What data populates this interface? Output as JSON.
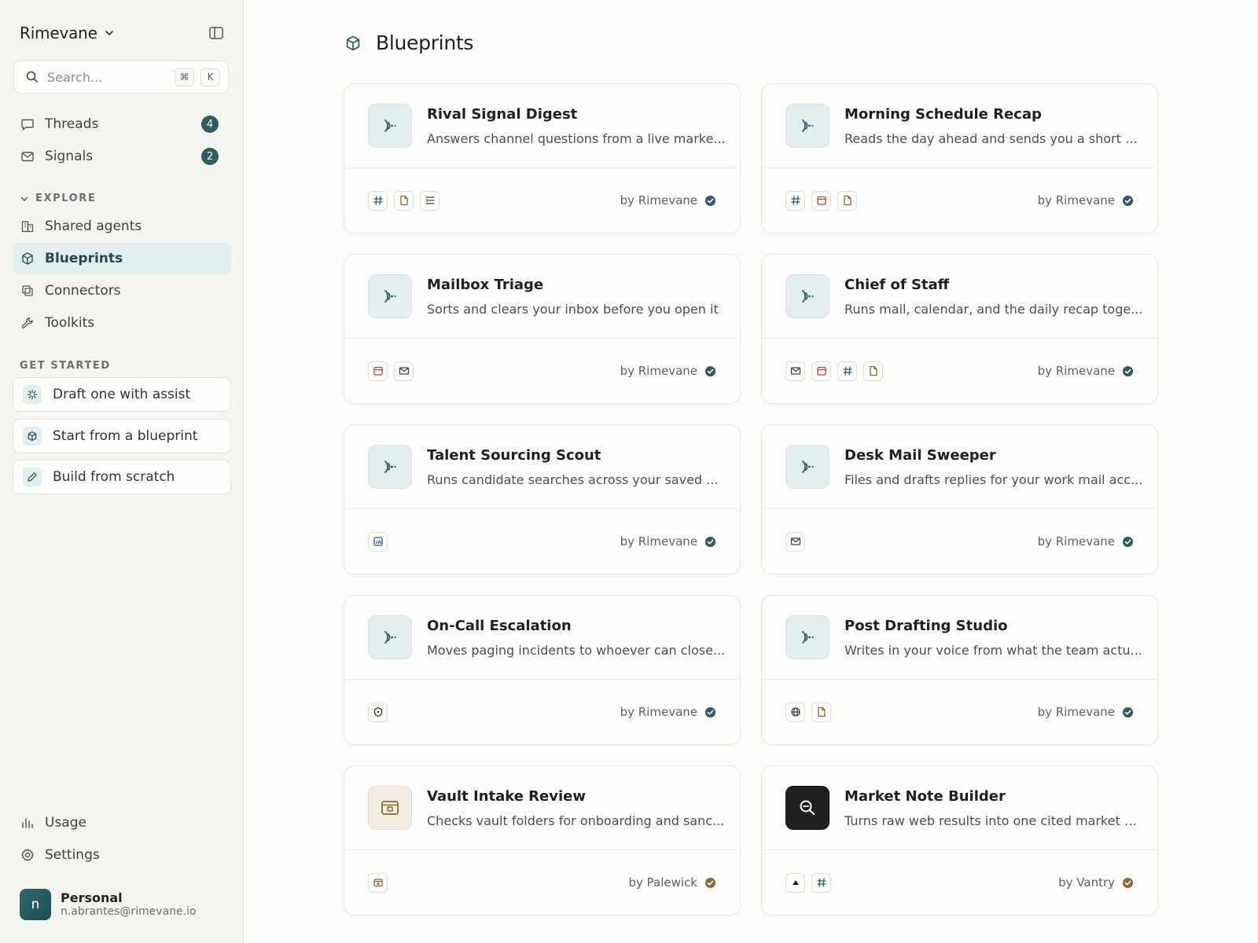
{
  "workspace": {
    "name": "Rimevane"
  },
  "search": {
    "placeholder": "Search...",
    "kbd1": "⌘",
    "kbd2": "K"
  },
  "nav": {
    "threads": {
      "label": "Threads",
      "count": "4"
    },
    "signals": {
      "label": "Signals",
      "count": "2"
    },
    "explore_heading": "EXPLORE",
    "shared_agents": "Shared agents",
    "blueprints": "Blueprints",
    "connectors": "Connectors",
    "toolkits": "Toolkits",
    "get_started_heading": "GET STARTED",
    "draft_assist": "Draft one with assist",
    "start_blueprint": "Start from a blueprint",
    "build_scratch": "Build from scratch",
    "usage": "Usage",
    "settings": "Settings"
  },
  "profile": {
    "initial": "n",
    "name": "Personal",
    "email": "n.abrantes@rimevane.io"
  },
  "page": {
    "title": "Blueprints"
  },
  "colors": {
    "accent": "#2f5d63",
    "active_bg": "#e3efee",
    "gold_check": "#8a6d3b"
  },
  "cards": [
    {
      "title": "Rival Signal Digest",
      "desc": "Answers channel questions from a live marke...",
      "tools": [
        "hash-icon",
        "document-icon",
        "list-icon"
      ],
      "by": "by Rimevane",
      "tile": "agent-icon"
    },
    {
      "title": "Morning Schedule Recap",
      "desc": "Reads the day ahead and sends you a short b...",
      "tools": [
        "hash-icon",
        "calendar-icon",
        "document-icon"
      ],
      "by": "by Rimevane",
      "tile": "agent-icon"
    },
    {
      "title": "Mailbox Triage",
      "desc": "Sorts and clears your inbox before you open it",
      "tools": [
        "calendar-icon",
        "mail-icon"
      ],
      "by": "by Rimevane",
      "tile": "agent-icon"
    },
    {
      "title": "Chief of Staff",
      "desc": "Runs mail, calendar, and the daily recap toge...",
      "tools": [
        "mail-icon",
        "calendar-icon",
        "hash-icon",
        "document-icon"
      ],
      "by": "by Rimevane",
      "tile": "agent-icon"
    },
    {
      "title": "Talent Sourcing Scout",
      "desc": "Runs candidate searches across your saved ...",
      "tools": [
        "linkedin-icon"
      ],
      "by": "by Rimevane",
      "tile": "agent-icon"
    },
    {
      "title": "Desk Mail Sweeper",
      "desc": "Files and drafts replies for your work mail acc...",
      "tools": [
        "mail-icon"
      ],
      "by": "by Rimevane",
      "tile": "agent-icon"
    },
    {
      "title": "On-Call Escalation",
      "desc": "Moves paging incidents to whoever can close...",
      "tools": [
        "shield-icon"
      ],
      "by": "by Rimevane",
      "tile": "agent-icon"
    },
    {
      "title": "Post Drafting Studio",
      "desc": "Writes in your voice from what the team actu...",
      "tools": [
        "globe-icon",
        "document-icon"
      ],
      "by": "by Rimevane",
      "tile": "agent-icon"
    },
    {
      "title": "Vault Intake Review",
      "desc": "Checks vault folders for onboarding and sanc...",
      "tools": [
        "vault-icon"
      ],
      "by": "by Palewick",
      "tile": "vault-icon",
      "check": "gold"
    },
    {
      "title": "Market Note Builder",
      "desc": "Turns raw web results into one cited market n...",
      "tools": [
        "arrow-up-icon",
        "hash-icon"
      ],
      "by": "by Vantry",
      "tile": "search-zoom-icon",
      "check": "gold"
    }
  ]
}
